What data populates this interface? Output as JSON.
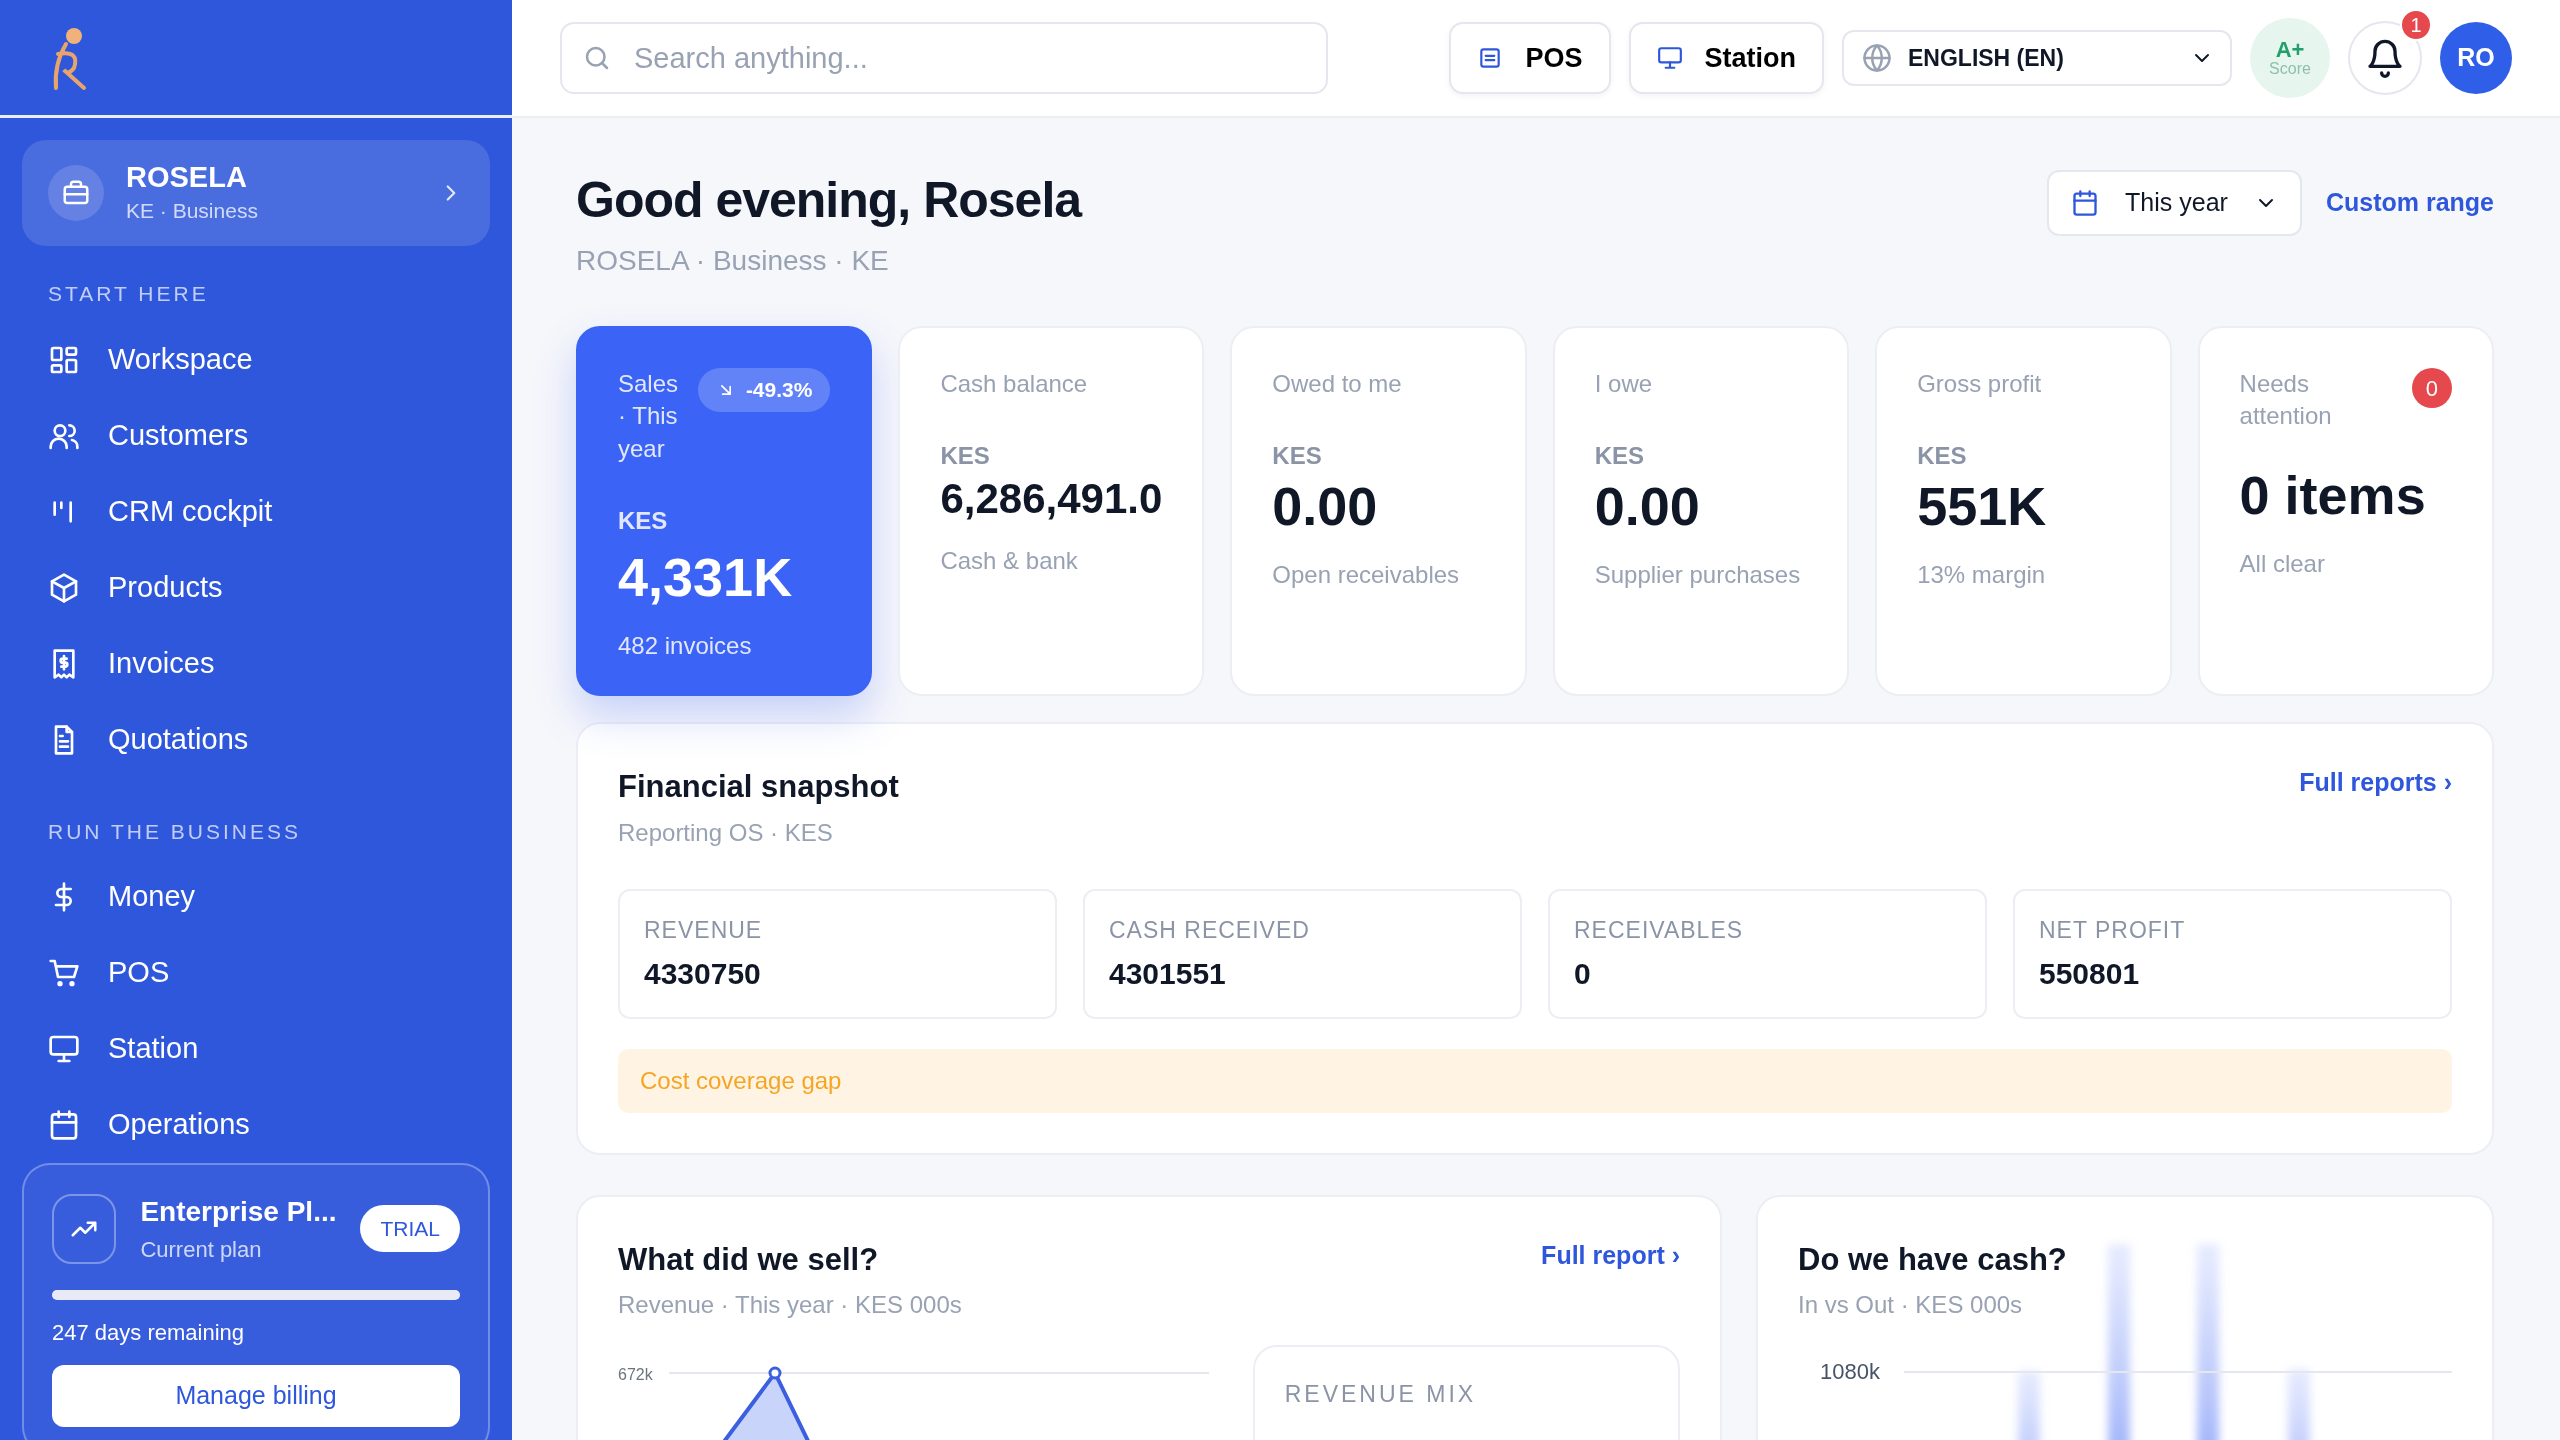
{
  "sidebar": {
    "org": {
      "name": "ROSELA",
      "subtitle": "KE · Business"
    },
    "sections": [
      {
        "title": "START HERE",
        "items": [
          {
            "label": "Workspace"
          },
          {
            "label": "Customers"
          },
          {
            "label": "CRM cockpit"
          },
          {
            "label": "Products"
          },
          {
            "label": "Invoices"
          },
          {
            "label": "Quotations"
          }
        ]
      },
      {
        "title": "RUN THE BUSINESS",
        "items": [
          {
            "label": "Money"
          },
          {
            "label": "POS"
          },
          {
            "label": "Station"
          },
          {
            "label": "Operations"
          }
        ]
      }
    ],
    "plan": {
      "name": "Enterprise Pl...",
      "badge": "TRIAL",
      "subtitle": "Current plan",
      "level": 1,
      "remaining": "247 days remaining",
      "button": "Manage billing"
    }
  },
  "topbar": {
    "search": {
      "placeholder": "Search anything..."
    },
    "buttons": [
      {
        "label": "POS"
      },
      {
        "label": "Station"
      }
    ],
    "language": "ENGLISH (EN)",
    "score": {
      "grade": "A+",
      "label": "Score"
    },
    "notifications": "1",
    "avatar": "RO"
  },
  "header": {
    "greeting": "Good evening, Rosela",
    "subtitle": "ROSELA · Business · KE",
    "period": "This year",
    "custom_range": "Custom range"
  },
  "kpis": [
    {
      "kind": "primary",
      "label": "Sales · This year",
      "trend": "-49.3%",
      "currency": "KES",
      "value": "4,331K",
      "note": "482 invoices"
    },
    {
      "kind": "plain",
      "label": "Cash balance",
      "currency": "KES",
      "value": "6,286,491.0",
      "note": "Cash & bank"
    },
    {
      "kind": "plain",
      "label": "Owed to me",
      "currency": "KES",
      "value": "0.00",
      "note": "Open receivables"
    },
    {
      "kind": "plain",
      "label": "I owe",
      "currency": "KES",
      "value": "0.00",
      "note": "Supplier purchases"
    },
    {
      "kind": "plain",
      "label": "Gross profit",
      "currency": "KES",
      "value": "551K",
      "note": "13% margin"
    },
    {
      "kind": "alert",
      "label": "Needs attention",
      "count": "0",
      "value": "0 items",
      "note": "All clear"
    }
  ],
  "snapshot": {
    "title": "Financial snapshot",
    "subtitle": "Reporting OS · KES",
    "link": "Full reports ›",
    "metrics": [
      {
        "label": "REVENUE",
        "value": "4330750"
      },
      {
        "label": "CASH RECEIVED",
        "value": "4301551"
      },
      {
        "label": "RECEIVABLES",
        "value": "0"
      },
      {
        "label": "NET PROFIT",
        "value": "550801"
      }
    ],
    "warning": "Cost coverage gap"
  },
  "sales_chart": {
    "title": "What did we sell?",
    "subtitle": "Revenue · This year · KES 000s",
    "link": "Full report ›",
    "axis_label": "672k",
    "mix_title": "REVENUE MIX"
  },
  "cash_chart": {
    "title": "Do we have cash?",
    "subtitle": "In vs Out · KES 000s",
    "axis_label": "1080k"
  }
}
